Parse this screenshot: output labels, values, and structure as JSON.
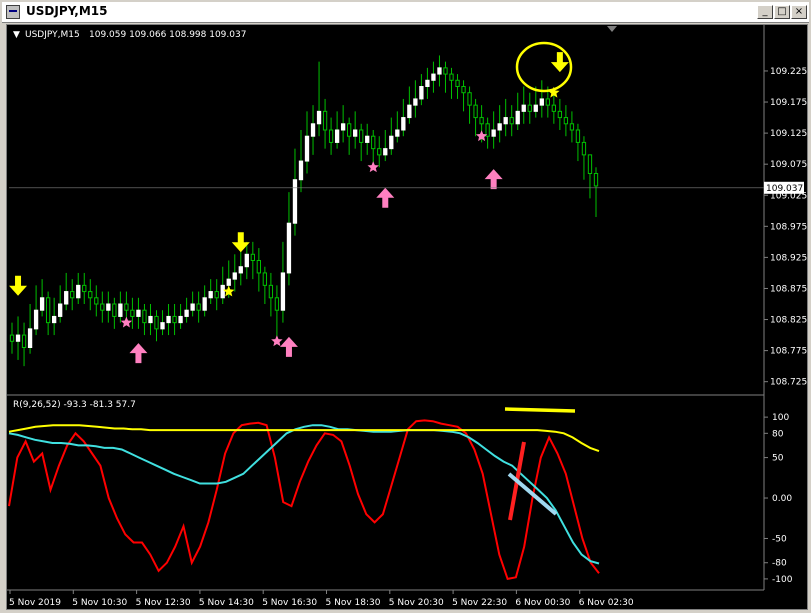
{
  "window": {
    "title": "USDJPY,M15",
    "minimize_label": "_",
    "restore_label": "□",
    "close_label": "×"
  },
  "colors": {
    "background": "#000000",
    "candle_up": "#ffffff",
    "candle_down": "#00c000",
    "wick": "#00c000",
    "grid": "#606060",
    "axis_text": "#ffffff",
    "yellow_arrow": "#ffff00",
    "pink_arrow": "#ff80c0",
    "osc_red": "#ff0000",
    "osc_cyan": "#40e0e0",
    "osc_yellow": "#ffff00",
    "annot_red": "#ff2020",
    "annot_lightblue": "#a0d8f0",
    "price_marker_bg": "#ffffff",
    "price_marker_text": "#000000"
  },
  "chart_data": [
    {
      "type": "candlestick",
      "title": "USDJPY,M15  109.059 109.066 108.998 109.037",
      "symbol_header": "USDJPY,M15",
      "ohlc_header": "109.059 109.066 108.998 109.037",
      "ylim": [
        108.71,
        109.27
      ],
      "yticks": [
        "109.225",
        "109.175",
        "109.125",
        "109.075",
        "109.025",
        "108.975",
        "108.925",
        "108.875",
        "108.825",
        "108.775",
        "108.725"
      ],
      "ytick_values": [
        109.225,
        109.175,
        109.125,
        109.075,
        109.025,
        108.975,
        108.925,
        108.875,
        108.825,
        108.775,
        108.725
      ],
      "current_price": "109.037",
      "current_price_value": 109.037,
      "grid": false,
      "closes": [
        108.79,
        108.8,
        108.78,
        108.81,
        108.84,
        108.86,
        108.82,
        108.83,
        108.85,
        108.87,
        108.86,
        108.88,
        108.87,
        108.86,
        108.85,
        108.84,
        108.85,
        108.83,
        108.85,
        108.84,
        108.83,
        108.84,
        108.82,
        108.83,
        108.81,
        108.82,
        108.83,
        108.82,
        108.83,
        108.84,
        108.85,
        108.84,
        108.86,
        108.87,
        108.86,
        108.88,
        108.89,
        108.9,
        108.91,
        108.93,
        108.92,
        108.9,
        108.88,
        108.86,
        108.84,
        108.9,
        108.98,
        109.05,
        109.08,
        109.12,
        109.14,
        109.16,
        109.13,
        109.11,
        109.13,
        109.14,
        109.12,
        109.13,
        109.11,
        109.12,
        109.1,
        109.09,
        109.1,
        109.12,
        109.13,
        109.15,
        109.17,
        109.18,
        109.2,
        109.21,
        109.22,
        109.23,
        109.22,
        109.21,
        109.2,
        109.19,
        109.17,
        109.15,
        109.14,
        109.12,
        109.13,
        109.14,
        109.15,
        109.14,
        109.16,
        109.17,
        109.16,
        109.17,
        109.18,
        109.17,
        109.16,
        109.15,
        109.14,
        109.13,
        109.11,
        109.09,
        109.06,
        109.04
      ],
      "opens": [
        108.8,
        108.79,
        108.8,
        108.78,
        108.81,
        108.84,
        108.86,
        108.82,
        108.83,
        108.85,
        108.87,
        108.86,
        108.88,
        108.87,
        108.86,
        108.85,
        108.84,
        108.85,
        108.83,
        108.85,
        108.84,
        108.83,
        108.84,
        108.82,
        108.83,
        108.81,
        108.82,
        108.83,
        108.82,
        108.83,
        108.84,
        108.85,
        108.84,
        108.86,
        108.87,
        108.86,
        108.88,
        108.89,
        108.9,
        108.91,
        108.93,
        108.92,
        108.9,
        108.88,
        108.86,
        108.84,
        108.9,
        108.98,
        109.05,
        109.08,
        109.12,
        109.14,
        109.16,
        109.13,
        109.11,
        109.13,
        109.14,
        109.12,
        109.13,
        109.11,
        109.12,
        109.1,
        109.09,
        109.1,
        109.12,
        109.13,
        109.15,
        109.17,
        109.18,
        109.2,
        109.21,
        109.22,
        109.23,
        109.22,
        109.21,
        109.2,
        109.19,
        109.17,
        109.15,
        109.14,
        109.12,
        109.13,
        109.14,
        109.15,
        109.14,
        109.16,
        109.17,
        109.16,
        109.17,
        109.18,
        109.17,
        109.16,
        109.15,
        109.14,
        109.13,
        109.11,
        109.09,
        109.06
      ],
      "highs": [
        108.82,
        108.83,
        108.82,
        108.85,
        108.88,
        108.89,
        108.87,
        108.86,
        108.88,
        108.9,
        108.89,
        108.9,
        108.9,
        108.89,
        108.88,
        108.87,
        108.87,
        108.86,
        108.87,
        108.87,
        108.86,
        108.86,
        108.85,
        108.85,
        108.84,
        108.84,
        108.85,
        108.85,
        108.85,
        108.86,
        108.87,
        108.87,
        108.88,
        108.89,
        108.89,
        108.91,
        108.92,
        108.93,
        108.94,
        108.95,
        108.95,
        108.94,
        108.91,
        108.9,
        108.88,
        108.95,
        109.03,
        109.1,
        109.13,
        109.16,
        109.17,
        109.24,
        109.18,
        109.15,
        109.16,
        109.17,
        109.15,
        109.16,
        109.14,
        109.14,
        109.13,
        109.12,
        109.13,
        109.15,
        109.16,
        109.18,
        109.2,
        109.21,
        109.22,
        109.23,
        109.24,
        109.25,
        109.24,
        109.23,
        109.22,
        109.21,
        109.2,
        109.18,
        109.17,
        109.15,
        109.16,
        109.17,
        109.18,
        109.17,
        109.19,
        109.2,
        109.19,
        109.2,
        109.21,
        109.2,
        109.19,
        109.18,
        109.17,
        109.16,
        109.14,
        109.12,
        109.08,
        109.07
      ],
      "lows": [
        108.77,
        108.76,
        108.75,
        108.77,
        108.8,
        108.83,
        108.8,
        108.8,
        108.82,
        108.84,
        108.84,
        108.85,
        108.85,
        108.84,
        108.83,
        108.82,
        108.82,
        108.81,
        108.82,
        108.82,
        108.81,
        108.81,
        108.8,
        108.8,
        108.79,
        108.8,
        108.8,
        108.8,
        108.81,
        108.82,
        108.83,
        108.82,
        108.83,
        108.85,
        108.84,
        108.85,
        108.86,
        108.87,
        108.88,
        108.89,
        108.89,
        108.87,
        108.85,
        108.83,
        108.79,
        108.82,
        108.88,
        108.96,
        109.03,
        109.06,
        109.09,
        109.12,
        109.1,
        109.09,
        109.1,
        109.11,
        109.09,
        109.1,
        109.08,
        109.09,
        109.07,
        109.07,
        109.08,
        109.09,
        109.11,
        109.12,
        109.14,
        109.15,
        109.17,
        109.18,
        109.19,
        109.2,
        109.19,
        109.18,
        109.18,
        109.16,
        109.14,
        109.12,
        109.11,
        109.1,
        109.1,
        109.11,
        109.12,
        109.12,
        109.13,
        109.14,
        109.14,
        109.15,
        109.15,
        109.15,
        109.14,
        109.13,
        109.12,
        109.11,
        109.08,
        109.05,
        109.02,
        108.99
      ]
    },
    {
      "type": "line",
      "title": "R(9,26,52) -93.3 -81.3 57.7",
      "header": "R(9,26,52) -93.3 -81.3 57.7",
      "ylim": [
        -110,
        115
      ],
      "yticks": [
        "100",
        "80",
        "50",
        "0.00",
        "-50",
        "-80",
        "-100"
      ],
      "ytick_values": [
        100,
        80,
        50,
        0,
        -50,
        -80,
        -100
      ],
      "series": [
        {
          "color": "#ff0000",
          "values": [
            -10,
            50,
            70,
            45,
            55,
            10,
            40,
            65,
            80,
            70,
            55,
            40,
            0,
            -25,
            -45,
            -55,
            -55,
            -70,
            -90,
            -80,
            -60,
            -35,
            -80,
            -60,
            -30,
            10,
            55,
            80,
            90,
            92,
            93,
            90,
            50,
            -5,
            -10,
            20,
            45,
            65,
            80,
            78,
            70,
            40,
            5,
            -20,
            -30,
            -20,
            15,
            50,
            85,
            95,
            96,
            95,
            92,
            90,
            88,
            80,
            60,
            30,
            -20,
            -70,
            -100,
            -98,
            -60,
            0,
            50,
            75,
            55,
            30,
            -10,
            -50,
            -80,
            -93
          ]
        },
        {
          "color": "#40e0e0",
          "values": [
            80,
            78,
            75,
            72,
            70,
            68,
            68,
            67,
            65,
            65,
            64,
            62,
            62,
            60,
            55,
            50,
            45,
            40,
            35,
            30,
            26,
            22,
            18,
            18,
            18,
            20,
            25,
            30,
            40,
            50,
            60,
            70,
            80,
            85,
            88,
            90,
            90,
            88,
            85,
            85,
            84,
            83,
            82,
            82,
            82,
            83,
            84,
            84,
            84,
            84,
            83,
            82,
            80,
            75,
            68,
            60,
            52,
            45,
            40,
            30,
            20,
            10,
            0,
            -15,
            -35,
            -55,
            -70,
            -78,
            -81
          ]
        },
        {
          "color": "#ffff00",
          "values": [
            82,
            84,
            86,
            88,
            89,
            90,
            90,
            90,
            90,
            89,
            88,
            87,
            86,
            86,
            85,
            85,
            84,
            84,
            84,
            84,
            84,
            84,
            84,
            84,
            84,
            84,
            84,
            84,
            84,
            84,
            84,
            84,
            84,
            84,
            84,
            84,
            84,
            84,
            84,
            84,
            84,
            84,
            84,
            84,
            84,
            84,
            84,
            84,
            84,
            84,
            84,
            84,
            84,
            84,
            84,
            84,
            84,
            84,
            84,
            84,
            84,
            83,
            82,
            80,
            75,
            68,
            62,
            58
          ]
        }
      ]
    }
  ],
  "xaxis": {
    "ticks": [
      "5 Nov 2019",
      "5 Nov 10:30",
      "5 Nov 12:30",
      "5 Nov 14:30",
      "5 Nov 16:30",
      "5 Nov 18:30",
      "5 Nov 20:30",
      "5 Nov 22:30",
      "6 Nov 00:30",
      "6 Nov 02:30"
    ]
  },
  "signals": {
    "yellow_down": [
      {
        "index": 1,
        "price": 108.86
      },
      {
        "index": 38,
        "price": 108.93
      },
      {
        "index": 91,
        "price": 109.22
      }
    ],
    "yellow_star": [
      {
        "index": 36,
        "price": 108.87
      },
      {
        "index": 90,
        "price": 109.19
      }
    ],
    "pink_up": [
      {
        "index": 21,
        "price": 108.8
      },
      {
        "index": 46,
        "price": 108.81
      },
      {
        "index": 62,
        "price": 109.05
      },
      {
        "index": 80,
        "price": 109.08
      }
    ],
    "pink_star": [
      {
        "index": 19,
        "price": 108.82
      },
      {
        "index": 44,
        "price": 108.79
      },
      {
        "index": 60,
        "price": 109.07
      },
      {
        "index": 78,
        "price": 109.12
      }
    ]
  }
}
